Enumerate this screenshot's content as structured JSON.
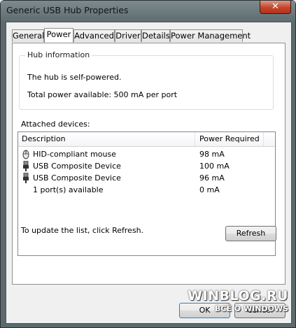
{
  "window": {
    "title": "Generic USB Hub Properties",
    "close_glyph": "✕"
  },
  "tabs": [
    {
      "label": "General"
    },
    {
      "label": "Power"
    },
    {
      "label": "Advanced"
    },
    {
      "label": "Driver"
    },
    {
      "label": "Details"
    },
    {
      "label": "Power Management"
    }
  ],
  "hub_info": {
    "legend": "Hub information",
    "status": "The hub is self-powered.",
    "total_power": "Total power available:  500 mA per port"
  },
  "attached": {
    "label": "Attached devices:",
    "headers": {
      "description": "Description",
      "power": "Power Required"
    },
    "rows": [
      {
        "description": "HID-compliant mouse",
        "power": "98 mA",
        "icon": "mouse-icon"
      },
      {
        "description": "USB Composite Device",
        "power": "100 mA",
        "icon": "usb-plug-icon"
      },
      {
        "description": "USB Composite Device",
        "power": "96 mA",
        "icon": "usb-plug-icon"
      },
      {
        "description": "1 port(s) available",
        "power": "0 mA",
        "icon": ""
      }
    ]
  },
  "footer": {
    "hint": "To update the list, click Refresh.",
    "refresh_label": "Refresh",
    "ok_label": "OK",
    "cancel_label": "Cancel"
  },
  "watermark": {
    "line1": "WINBLOG.RU",
    "line2": "ВСЁ О WINDOWS"
  }
}
